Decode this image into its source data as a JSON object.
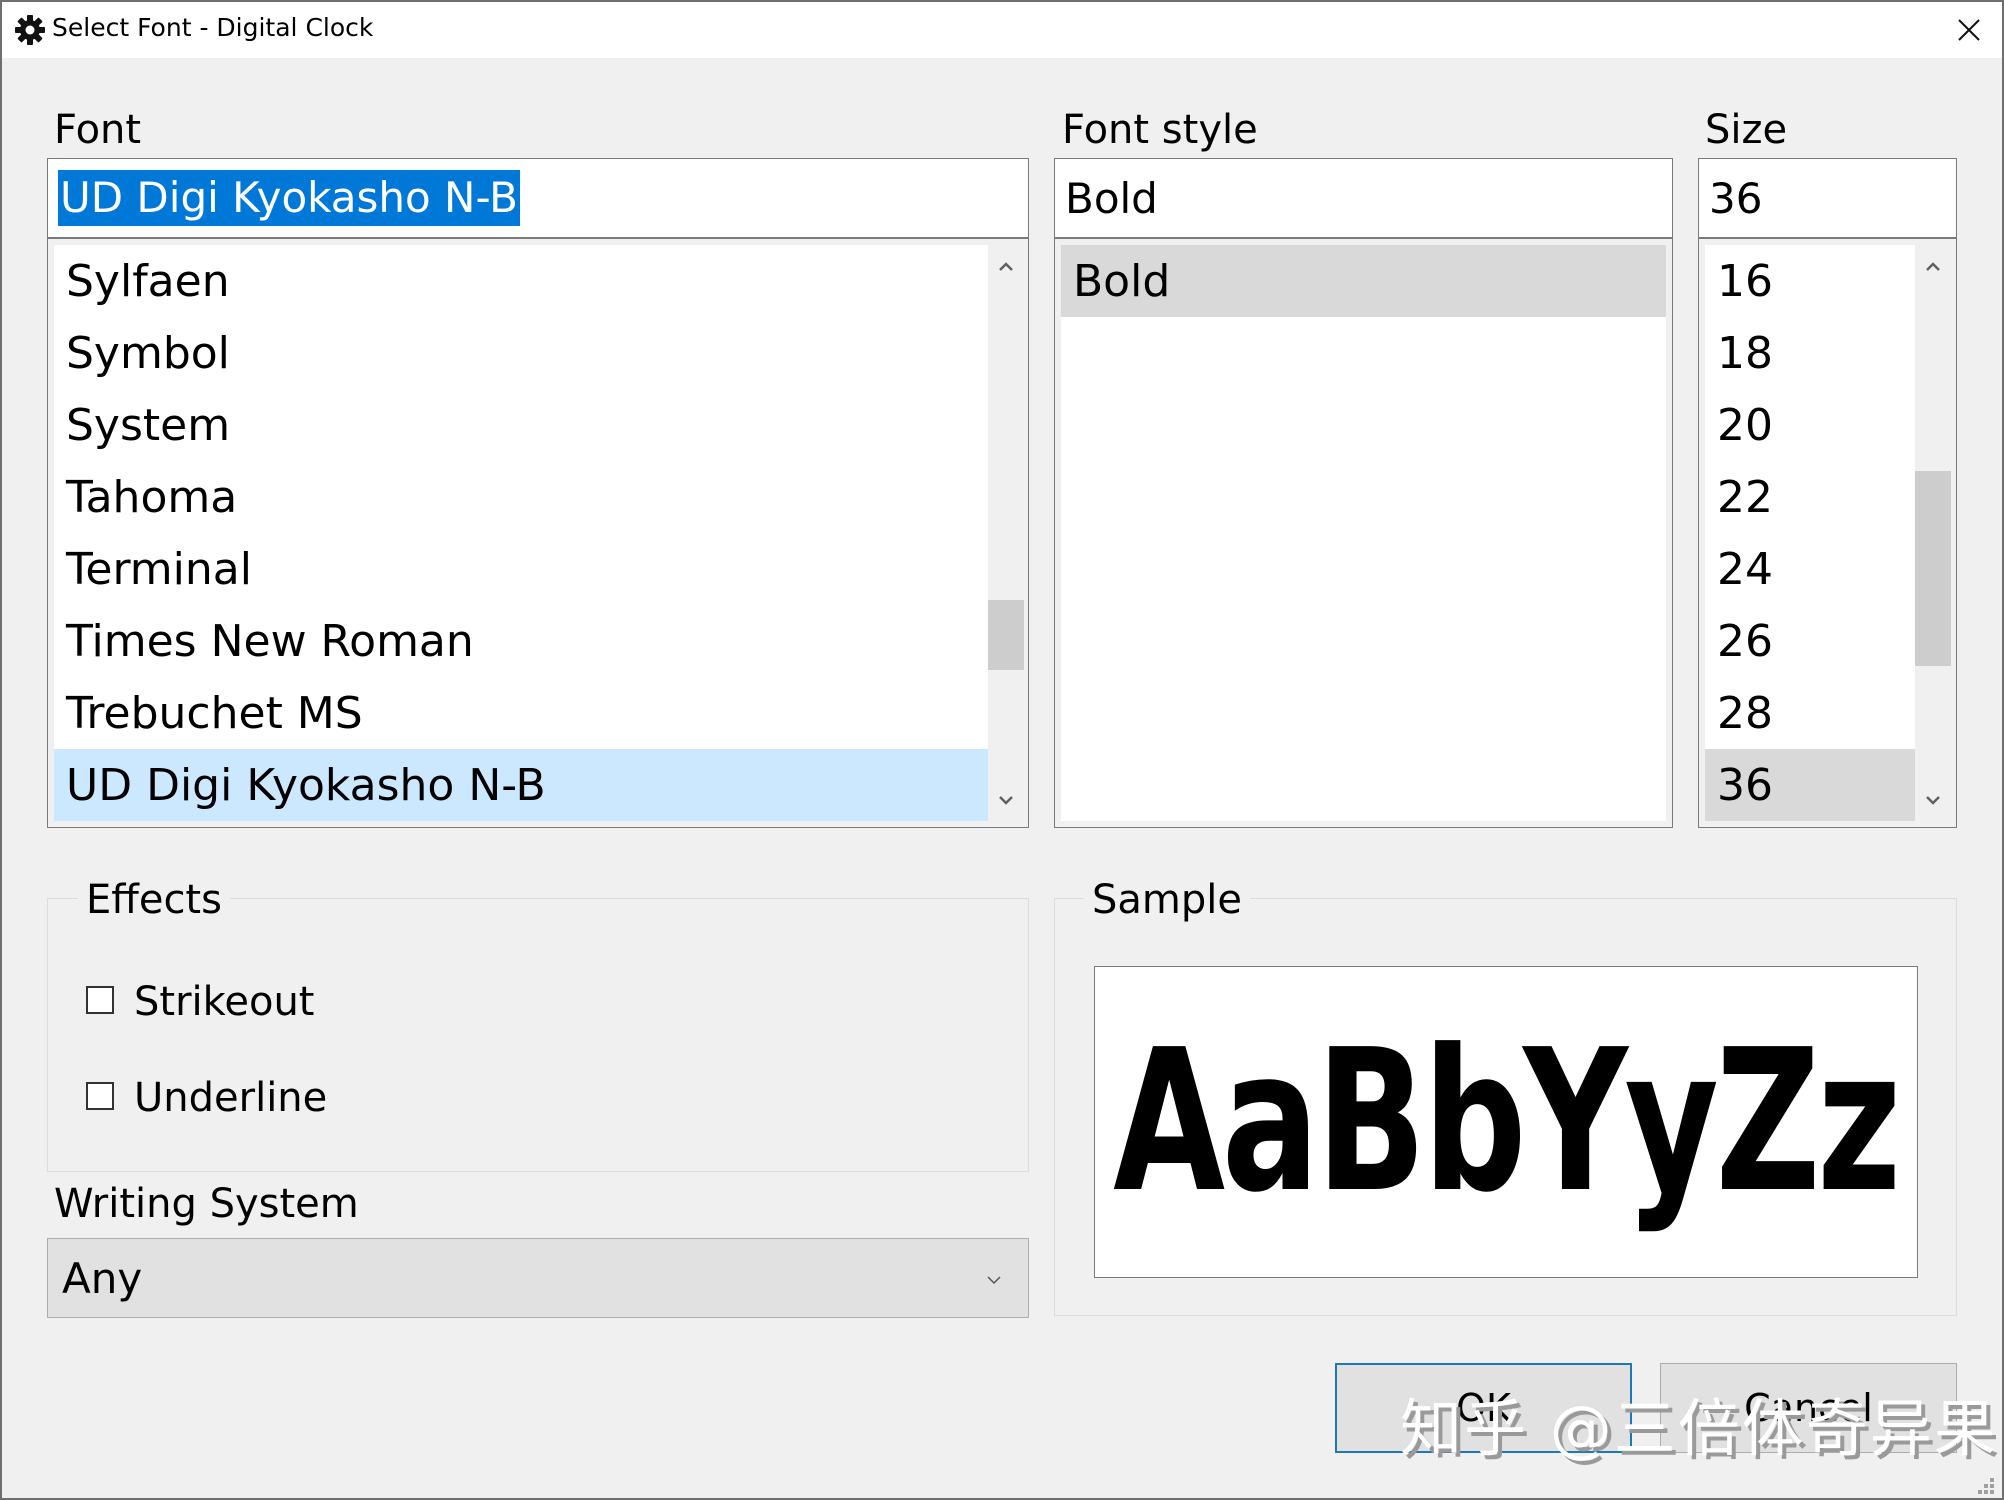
{
  "window": {
    "title": "Select Font - Digital Clock",
    "icon": "gear-icon",
    "close_icon": "close-icon"
  },
  "font": {
    "label": "Font",
    "value": "UD Digi Kyokasho N-B",
    "items": [
      "Sylfaen",
      "Symbol",
      "System",
      "Tahoma",
      "Terminal",
      "Times New Roman",
      "Trebuchet MS",
      "UD Digi Kyokasho N-B"
    ],
    "selected_index": 7,
    "scroll_position_fraction": 0.78
  },
  "font_style": {
    "label": "Font style",
    "value": "Bold",
    "items": [
      "Bold"
    ],
    "selected_index": 0
  },
  "size": {
    "label": "Size",
    "value": "36",
    "items": [
      "16",
      "18",
      "20",
      "22",
      "24",
      "26",
      "28",
      "36"
    ],
    "selected_index": 7,
    "scroll_position_fraction": 0.55
  },
  "effects": {
    "label": "Effects",
    "strikeout": {
      "label": "Strikeout",
      "checked": false
    },
    "underline": {
      "label": "Underline",
      "checked": false
    }
  },
  "writing_system": {
    "label": "Writing System",
    "value": "Any"
  },
  "sample": {
    "label": "Sample",
    "text": "AaBbYyZz"
  },
  "buttons": {
    "ok": "OK",
    "cancel": "Cancel"
  },
  "watermark": "知乎 @三倍体奇异果",
  "colors": {
    "selection_blue": "#0078d7",
    "list_selection": "#cce8ff",
    "inactive_selection": "#d9d9d9",
    "default_button_border": "#1f78b4"
  }
}
